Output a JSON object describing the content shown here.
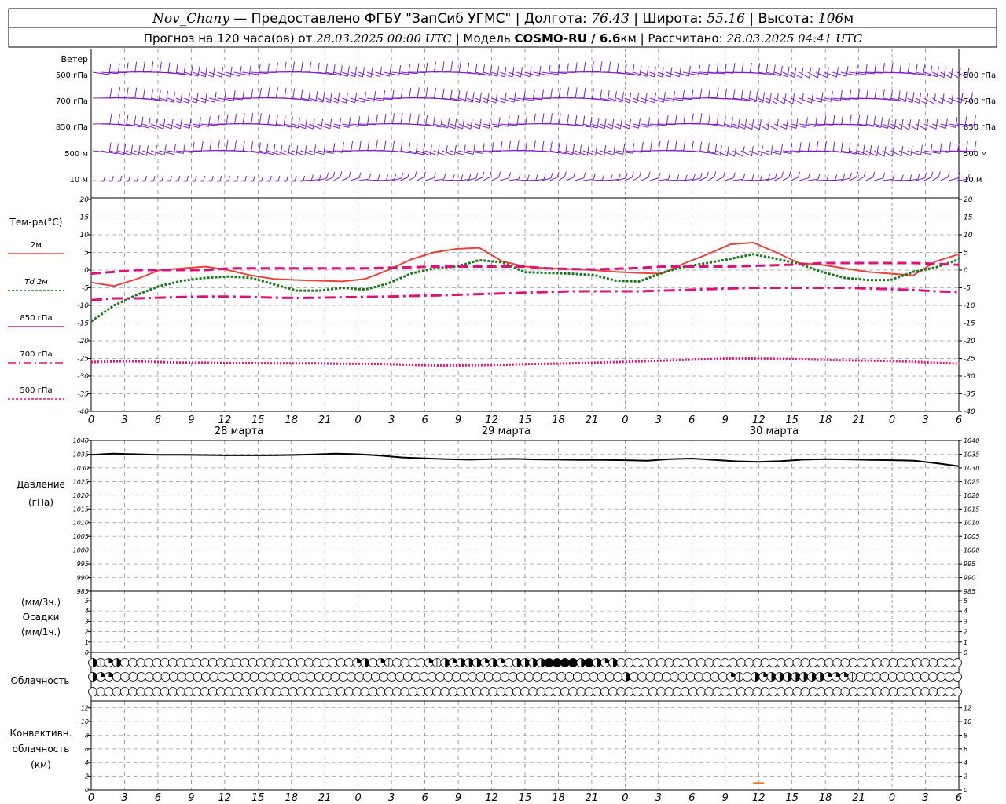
{
  "header": {
    "line1": {
      "station": "Nov_Chany",
      "provider": " — Предоставлено ФГБУ \"ЗапСиб УГМС\" | Долгота: ",
      "lon": "76.43",
      "lat_label": " | Широта: ",
      "lat": "55.16",
      "alt_label": " | Высота: ",
      "alt": "106",
      "alt_unit": "м"
    },
    "line2": {
      "forecast": "Прогноз на 120 часа(ов) от ",
      "init": "28.03.2025 00:00 UTC",
      "model_label": "  | Модель ",
      "model": "COSMO-RU / 6.6",
      "model_unit": "км",
      "calc_label": " | Рассчитано: ",
      "calc": "28.03.2025 04:41 UTC"
    }
  },
  "wind_panel": {
    "title": "Ветер",
    "levels": [
      "500 гПа",
      "700 гПа",
      "850 гПа",
      "500 м",
      "10  м"
    ],
    "levels_right": [
      "500 гПа",
      "700 гПа",
      "850 гПа",
      "500 м",
      "10  м"
    ],
    "barb_color": "#7b1fc9"
  },
  "temp_panel": {
    "title": "Тем-ра(°С)",
    "legend": [
      {
        "label": "2м",
        "color": "#e8443a",
        "style": "solid"
      },
      {
        "label": "Td  2м",
        "color": "#1a7a1a",
        "style": "dotted"
      },
      {
        "label": "850 гПа",
        "color": "#e0107a",
        "style": "dashed"
      },
      {
        "label": "700 гПа",
        "color": "#e0107a",
        "style": "dashdot"
      },
      {
        "label": "500 гПа",
        "color": "#e0107a",
        "style": "dotted"
      }
    ]
  },
  "pressure_panel": {
    "title": "Давление",
    "unit": "(гПа)"
  },
  "precip_panel": {
    "unit1": "(мм/3ч.)",
    "title": "Осадки",
    "unit2": "(мм/1ч.)"
  },
  "cloud_panel": {
    "title": "Облачность"
  },
  "conv_panel": {
    "title1": "Конвективн.",
    "title2": "облачность",
    "unit": "(км)"
  },
  "time_axis": {
    "hour_labels": [
      "0",
      "3",
      "6",
      "9",
      "12",
      "15",
      "18",
      "21",
      "0",
      "3",
      "6",
      "9",
      "12",
      "15",
      "18",
      "21",
      "0",
      "3",
      "6",
      "9",
      "12",
      "15",
      "18",
      "21",
      "0",
      "3",
      "6"
    ],
    "date_labels": [
      "28 марта",
      "29 марта",
      "30 марта"
    ]
  },
  "chart_data": [
    {
      "type": "line",
      "title": "Тем-ра(°С)",
      "x_hours": [
        0,
        3,
        6,
        9,
        12,
        15,
        18,
        21,
        24,
        27,
        30,
        33,
        36,
        39,
        42,
        45,
        48,
        51,
        54,
        57,
        60,
        63,
        66,
        69,
        72,
        75,
        78
      ],
      "ylim": [
        -40,
        20
      ],
      "yticks": [
        20,
        15,
        10,
        5,
        0,
        -5,
        -10,
        -15,
        -20,
        -25,
        -30,
        -35,
        -40
      ],
      "series": [
        {
          "name": "2м",
          "color": "#e8443a",
          "dash": "",
          "width": 2,
          "values": [
            -3.5,
            -4.5,
            -2.5,
            0,
            0.5,
            1,
            0,
            -1.5,
            -2.5,
            -2.8,
            -3,
            -3.2,
            -2.5,
            0,
            3,
            5,
            6,
            6.3,
            2.5,
            1,
            0.5,
            0.3,
            0,
            -0.5,
            -0.8,
            -1,
            2,
            4.5,
            7.3,
            7.8,
            5,
            2,
            1.5,
            0.5,
            -0.5,
            -1,
            -1.5,
            2.5,
            4.5
          ]
        },
        {
          "name": "Td  2м",
          "color": "#1a7a1a",
          "dash": "3,2",
          "width": 3,
          "values": [
            -14.5,
            -10,
            -7,
            -4.5,
            -3,
            -2.2,
            -1.8,
            -2.2,
            -4,
            -5.8,
            -5.8,
            -5,
            -5.5,
            -3.8,
            -1,
            0.5,
            1,
            2.8,
            2.2,
            -0.6,
            -0.8,
            -1,
            -1.4,
            -3,
            -3.2,
            -0.8,
            1,
            2,
            3.2,
            4.5,
            3.2,
            1.8,
            -0.5,
            -2.2,
            -2.8,
            -2.8,
            -0.5,
            0.8,
            3
          ]
        },
        {
          "name": "850 гПа",
          "color": "#e0107a",
          "dash": "12,6",
          "width": 3,
          "values": [
            -1,
            -0.5,
            0,
            0,
            0,
            0,
            0.5,
            0.5,
            0.5,
            0.5,
            0.5,
            0.5,
            0.5,
            0.7,
            0.8,
            1,
            1,
            1,
            1,
            1,
            0.5,
            0.3,
            0.2,
            0.4,
            0.6,
            1,
            1,
            1,
            1,
            1.2,
            1.4,
            1.6,
            2,
            2,
            2,
            2,
            2,
            1.8,
            1.5
          ]
        },
        {
          "name": "700 гПа",
          "color": "#e0107a",
          "dash": "14,5,3,5",
          "width": 3,
          "values": [
            -8.5,
            -8,
            -8,
            -7.8,
            -7.6,
            -7.5,
            -7.5,
            -7.6,
            -7.8,
            -7.9,
            -7.8,
            -7.7,
            -7.6,
            -7.5,
            -7.3,
            -7.2,
            -7,
            -6.8,
            -6.6,
            -6.4,
            -6.2,
            -6,
            -6,
            -6,
            -6,
            -5.8,
            -5.6,
            -5.4,
            -5.2,
            -5.0,
            -5.0,
            -5.0,
            -5.0,
            -5.0,
            -5.2,
            -5.4,
            -5.6,
            -6.0,
            -6.2
          ]
        },
        {
          "name": "500 гПа",
          "color": "#e0107a",
          "dash": "2,2",
          "width": 3,
          "values": [
            -26,
            -25.8,
            -25.8,
            -26,
            -26.2,
            -26.2,
            -26.3,
            -26.3,
            -26.4,
            -26.4,
            -26.4,
            -26.5,
            -26.5,
            -26.6,
            -26.8,
            -27,
            -27,
            -26.9,
            -26.8,
            -26.6,
            -26.5,
            -26.4,
            -26.2,
            -26,
            -25.8,
            -25.6,
            -25.4,
            -25.2,
            -25,
            -25,
            -25.1,
            -25.2,
            -25.4,
            -25.5,
            -25.6,
            -25.7,
            -25.9,
            -26.2,
            -26.5
          ]
        }
      ]
    },
    {
      "type": "line",
      "title": "Давление",
      "ylabel": "(гПа)",
      "ylim": [
        985,
        1040
      ],
      "yticks": [
        1040,
        1035,
        1030,
        1025,
        1020,
        1015,
        1010,
        1005,
        1000,
        995,
        990,
        985
      ],
      "series": [
        {
          "name": "Давление",
          "color": "#000000",
          "dash": "",
          "width": 2,
          "values": [
            1034.8,
            1035.2,
            1035,
            1034.8,
            1034.8,
            1034.7,
            1034.6,
            1034.6,
            1034.6,
            1034.7,
            1034.9,
            1035.2,
            1035,
            1034.5,
            1033.8,
            1033.5,
            1033.2,
            1033.0,
            1033.2,
            1033.3,
            1033.1,
            1033.0,
            1032.9,
            1032.9,
            1032.8,
            1032.6,
            1033.2,
            1033.4,
            1032.9,
            1032.4,
            1032.2,
            1032.5,
            1033.0,
            1033.2,
            1033.1,
            1032.9,
            1032.8,
            1032.6,
            1031.7,
            1030.6
          ]
        }
      ]
    },
    {
      "type": "bar",
      "title": "Осадки",
      "ylim": [
        0,
        5
      ],
      "yticks": [
        5,
        4,
        3,
        2,
        1,
        0
      ],
      "values": []
    },
    {
      "type": "scatter",
      "title": "Облачность",
      "rows": [
        [
          3,
          1,
          2,
          3,
          0,
          0,
          0,
          0,
          0,
          0,
          0,
          0,
          0,
          0,
          0,
          0,
          0,
          0,
          0,
          0,
          0,
          0,
          0,
          0,
          0,
          0,
          0,
          0,
          0,
          0,
          0,
          0,
          0,
          2,
          3,
          1,
          2,
          1,
          0,
          0,
          0,
          0,
          2,
          1,
          3,
          2,
          3,
          3,
          3,
          2,
          3,
          2,
          1,
          3,
          3,
          3,
          3,
          4,
          4,
          4,
          4,
          3,
          4,
          3,
          2,
          3,
          0,
          0,
          0,
          0,
          0,
          0,
          0,
          0,
          0,
          0,
          0,
          0,
          0,
          0,
          0,
          0,
          0,
          0,
          0,
          0,
          0,
          0,
          0,
          0,
          0,
          0,
          0,
          0,
          0,
          0,
          0,
          0,
          0,
          0,
          0,
          0,
          0,
          0,
          0,
          0,
          0,
          0,
          0
        ],
        [
          3,
          2,
          2,
          0,
          0,
          0,
          0,
          0,
          0,
          0,
          0,
          0,
          0,
          0,
          0,
          0,
          0,
          0,
          0,
          0,
          0,
          0,
          0,
          0,
          0,
          0,
          0,
          0,
          0,
          0,
          0,
          0,
          0,
          0,
          0,
          0,
          0,
          0,
          0,
          0,
          0,
          0,
          0,
          0,
          0,
          0,
          0,
          0,
          0,
          0,
          0,
          0,
          0,
          0,
          0,
          0,
          0,
          0,
          0,
          0,
          0,
          0,
          0,
          0,
          0,
          0,
          3,
          0,
          0,
          0,
          0,
          0,
          0,
          0,
          0,
          0,
          0,
          0,
          0,
          2,
          1,
          0,
          3,
          2,
          3,
          3,
          3,
          3,
          3,
          3,
          3,
          2,
          2,
          2,
          1,
          0,
          0,
          0,
          0,
          0,
          0,
          0,
          0,
          0,
          0,
          0,
          0,
          0
        ],
        [
          0,
          0,
          0,
          0,
          0,
          0,
          0,
          0,
          0,
          0,
          0,
          0,
          0,
          0,
          0,
          0,
          0,
          0,
          0,
          0,
          0,
          0,
          0,
          0,
          0,
          0,
          0,
          0,
          0,
          0,
          0,
          0,
          0,
          0,
          0,
          0,
          0,
          0,
          0,
          0,
          0,
          0,
          0,
          0,
          0,
          0,
          0,
          0,
          0,
          0,
          0,
          0,
          0,
          0,
          0,
          0,
          0,
          0,
          0,
          0,
          0,
          0,
          0,
          0,
          0,
          0,
          0,
          0,
          0,
          0,
          0,
          0,
          0,
          0,
          0,
          0,
          0,
          0,
          0,
          0,
          0,
          0,
          0,
          0,
          0,
          0,
          0,
          0,
          0,
          0,
          0,
          0,
          0,
          0,
          0,
          0,
          0,
          0,
          0,
          0,
          0,
          0,
          0,
          0,
          0,
          0,
          0,
          0,
          0
        ]
      ]
    },
    {
      "type": "bar",
      "title": "Конвективн. облачность",
      "ylabel": "(км)",
      "ylim": [
        0,
        13
      ],
      "yticks": [
        12,
        10,
        8,
        6,
        4,
        2,
        0
      ],
      "color": "#e87a1a",
      "segments": [
        {
          "x_hour": 60,
          "value": 1
        }
      ]
    }
  ]
}
